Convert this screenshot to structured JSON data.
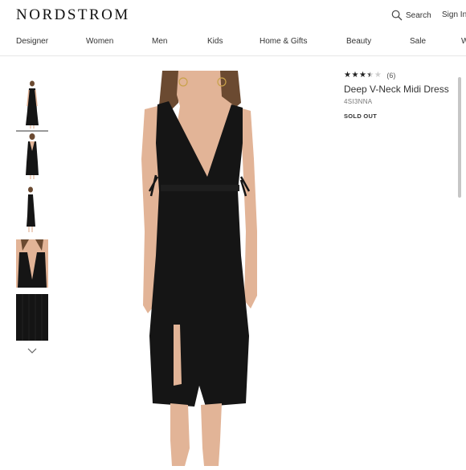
{
  "header": {
    "logo": "NORDSTROM",
    "search_label": "Search",
    "signin_label": "Sign In"
  },
  "nav": {
    "items": [
      {
        "label": "Designer"
      },
      {
        "label": "Women"
      },
      {
        "label": "Men"
      },
      {
        "label": "Kids"
      },
      {
        "label": "Home & Gifts"
      },
      {
        "label": "Beauty"
      },
      {
        "label": "Sale"
      },
      {
        "label": "W"
      }
    ]
  },
  "product": {
    "rating": 3.5,
    "rating_max": 5,
    "review_count": "(6)",
    "title": "Deep V-Neck Midi Dress",
    "sku": "4SI3NNA",
    "status": "SOLD OUT"
  },
  "thumbnails": {
    "count": 5,
    "selected_index": 0,
    "more_icon": "chevron-down-icon"
  },
  "colors": {
    "dress": "#151515",
    "skin": "#e2b497",
    "hair": "#6b4a31",
    "selected_thumb_border": "#999999"
  }
}
